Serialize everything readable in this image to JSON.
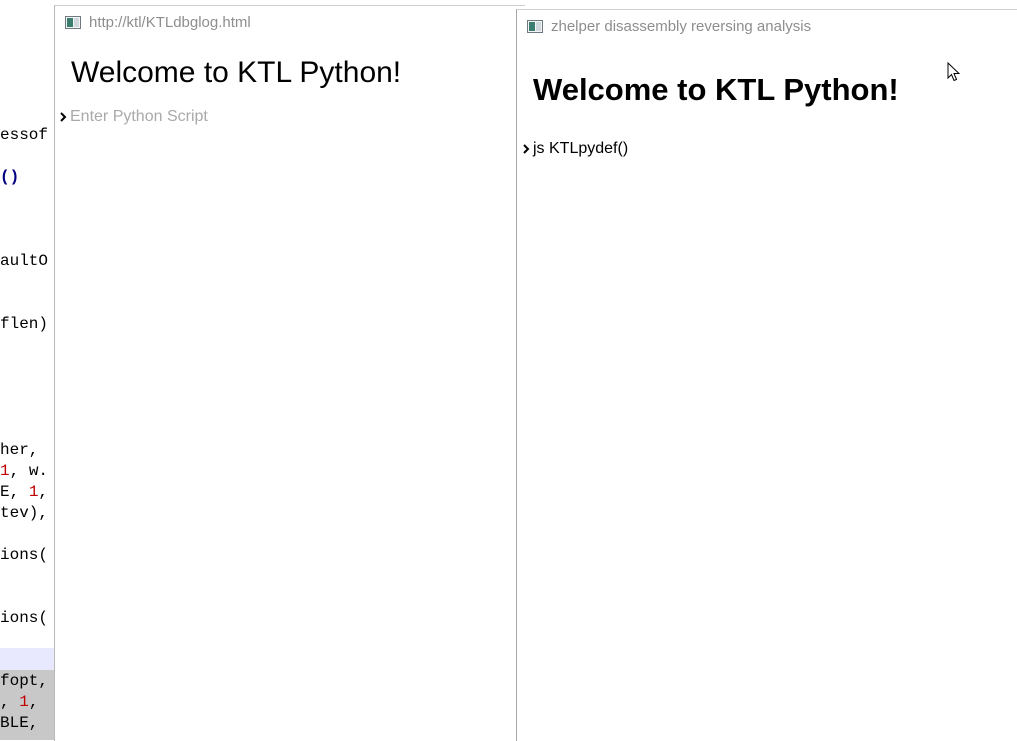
{
  "background_editor": {
    "lines": [
      {
        "text": "essof"
      },
      {
        "text": "()"
      },
      {
        "text": "aultO"
      },
      {
        "text": "flen)"
      },
      {
        "text": "her,"
      },
      {
        "pre": "",
        "num": "1",
        "post": ", w."
      },
      {
        "pre": "E, ",
        "num": "1",
        "post": ","
      },
      {
        "text": "tev),"
      },
      {
        "text": "ions("
      },
      {
        "text": "ions("
      },
      {
        "text": "fopt,"
      },
      {
        "pre": ", ",
        "num": "1",
        "post": ","
      },
      {
        "text": "BLE,"
      }
    ]
  },
  "left_window": {
    "title": "http://ktl/KTLdbglog.html",
    "heading": "Welcome to KTL Python!",
    "input_placeholder": "Enter Python Script",
    "input_value": ""
  },
  "right_window": {
    "title": "zhelper disassembly reversing analysis",
    "heading": "Welcome to KTL Python!",
    "command_text": "js KTLpydef()"
  },
  "colors": {
    "title_text": "#8e8e8e",
    "placeholder": "#a9a9a9",
    "code_number": "#c00000",
    "code_paren": "#000080",
    "current_line_highlight": "#e8e8ff",
    "selection_highlight": "#c8c8c8"
  }
}
